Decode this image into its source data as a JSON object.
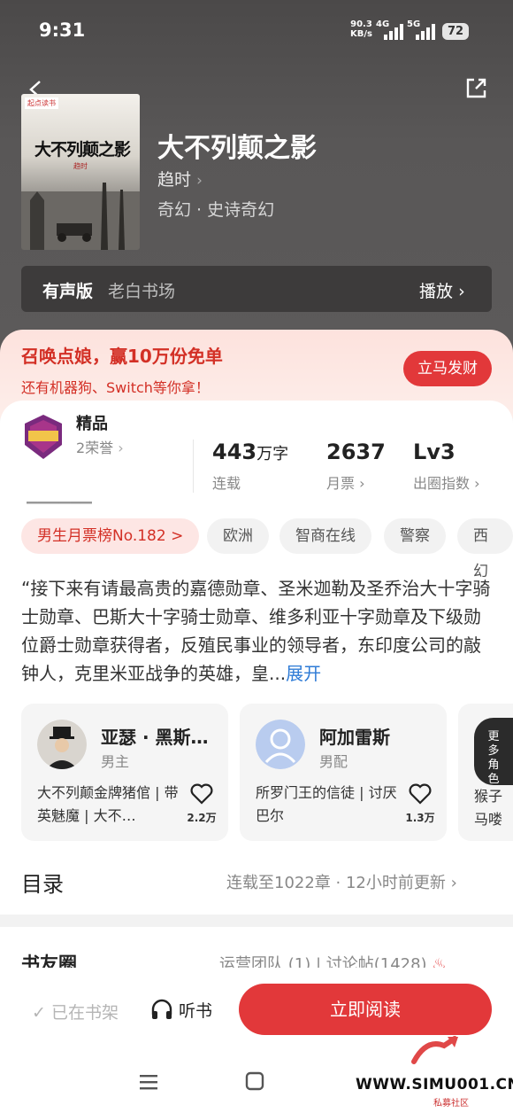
{
  "status": {
    "time": "9:31",
    "speed": "90.3",
    "speed_unit": "KB/s",
    "net1": "4G",
    "net2": "5G",
    "battery": "72"
  },
  "book": {
    "cover_badge": "起点读书",
    "cover_title": "大不列颠之影",
    "cover_author": "趋时",
    "title": "大不列颠之影",
    "author": "趋时",
    "genre": "奇幻 · 史诗奇幻"
  },
  "audio": {
    "label": "有声版",
    "source": "老白书场",
    "play": "播放"
  },
  "promo": {
    "title": "召唤点娘，赢10万份免单",
    "subtitle": "还有机器狗、Switch等你拿！",
    "button": "立马发财"
  },
  "stats": {
    "tag": "精品",
    "honor": "2荣誉",
    "words_num": "443",
    "words_unit": "万字",
    "words_label": "连载",
    "tickets_num": "2637",
    "tickets_label": "月票",
    "level_num": "Lv3",
    "level_label": "出圈指数"
  },
  "chips": [
    "男生月票榜No.182 >",
    "欧洲",
    "智商在线",
    "警察",
    "西幻"
  ],
  "description": "“接下来有请最高贵的嘉德勋章、圣米迦勒及圣乔治大十字骑士勋章、巴斯大十字骑士勋章、维多利亚十字勋章及下级勋位爵士勋章获得者，反殖民事业的领导者，东印度公司的敲钟人，克里米亚战争的英雄，皇...",
  "description_more": "展开",
  "characters": [
    {
      "name": "亚瑟 · 黑斯…",
      "role": "男主",
      "tags": "大不列颠金牌猪倌 | 带英魅魔 | 大不…",
      "likes": "2.2万"
    },
    {
      "name": "阿加雷斯",
      "role": "男配",
      "tags": "所罗门王的信徒 | 讨厌巴尔",
      "likes": "1.3万"
    },
    {
      "more_label": "更多角色",
      "tags": "猴子 马喽"
    }
  ],
  "toc": {
    "title": "目录",
    "info": "连载至1022章 · 12小时前更新"
  },
  "friends": {
    "title": "书友圈",
    "info": "运营团队 (1) | 讨论帖(1428)"
  },
  "bottom": {
    "shelf": "已在书架",
    "listen": "听书",
    "read": "立即阅读"
  },
  "watermark": {
    "text": "WWW.SIMU001.CN",
    "sub": "私募社区"
  },
  "colors": {
    "accent": "#e2383a",
    "link": "#2e7bd6"
  }
}
